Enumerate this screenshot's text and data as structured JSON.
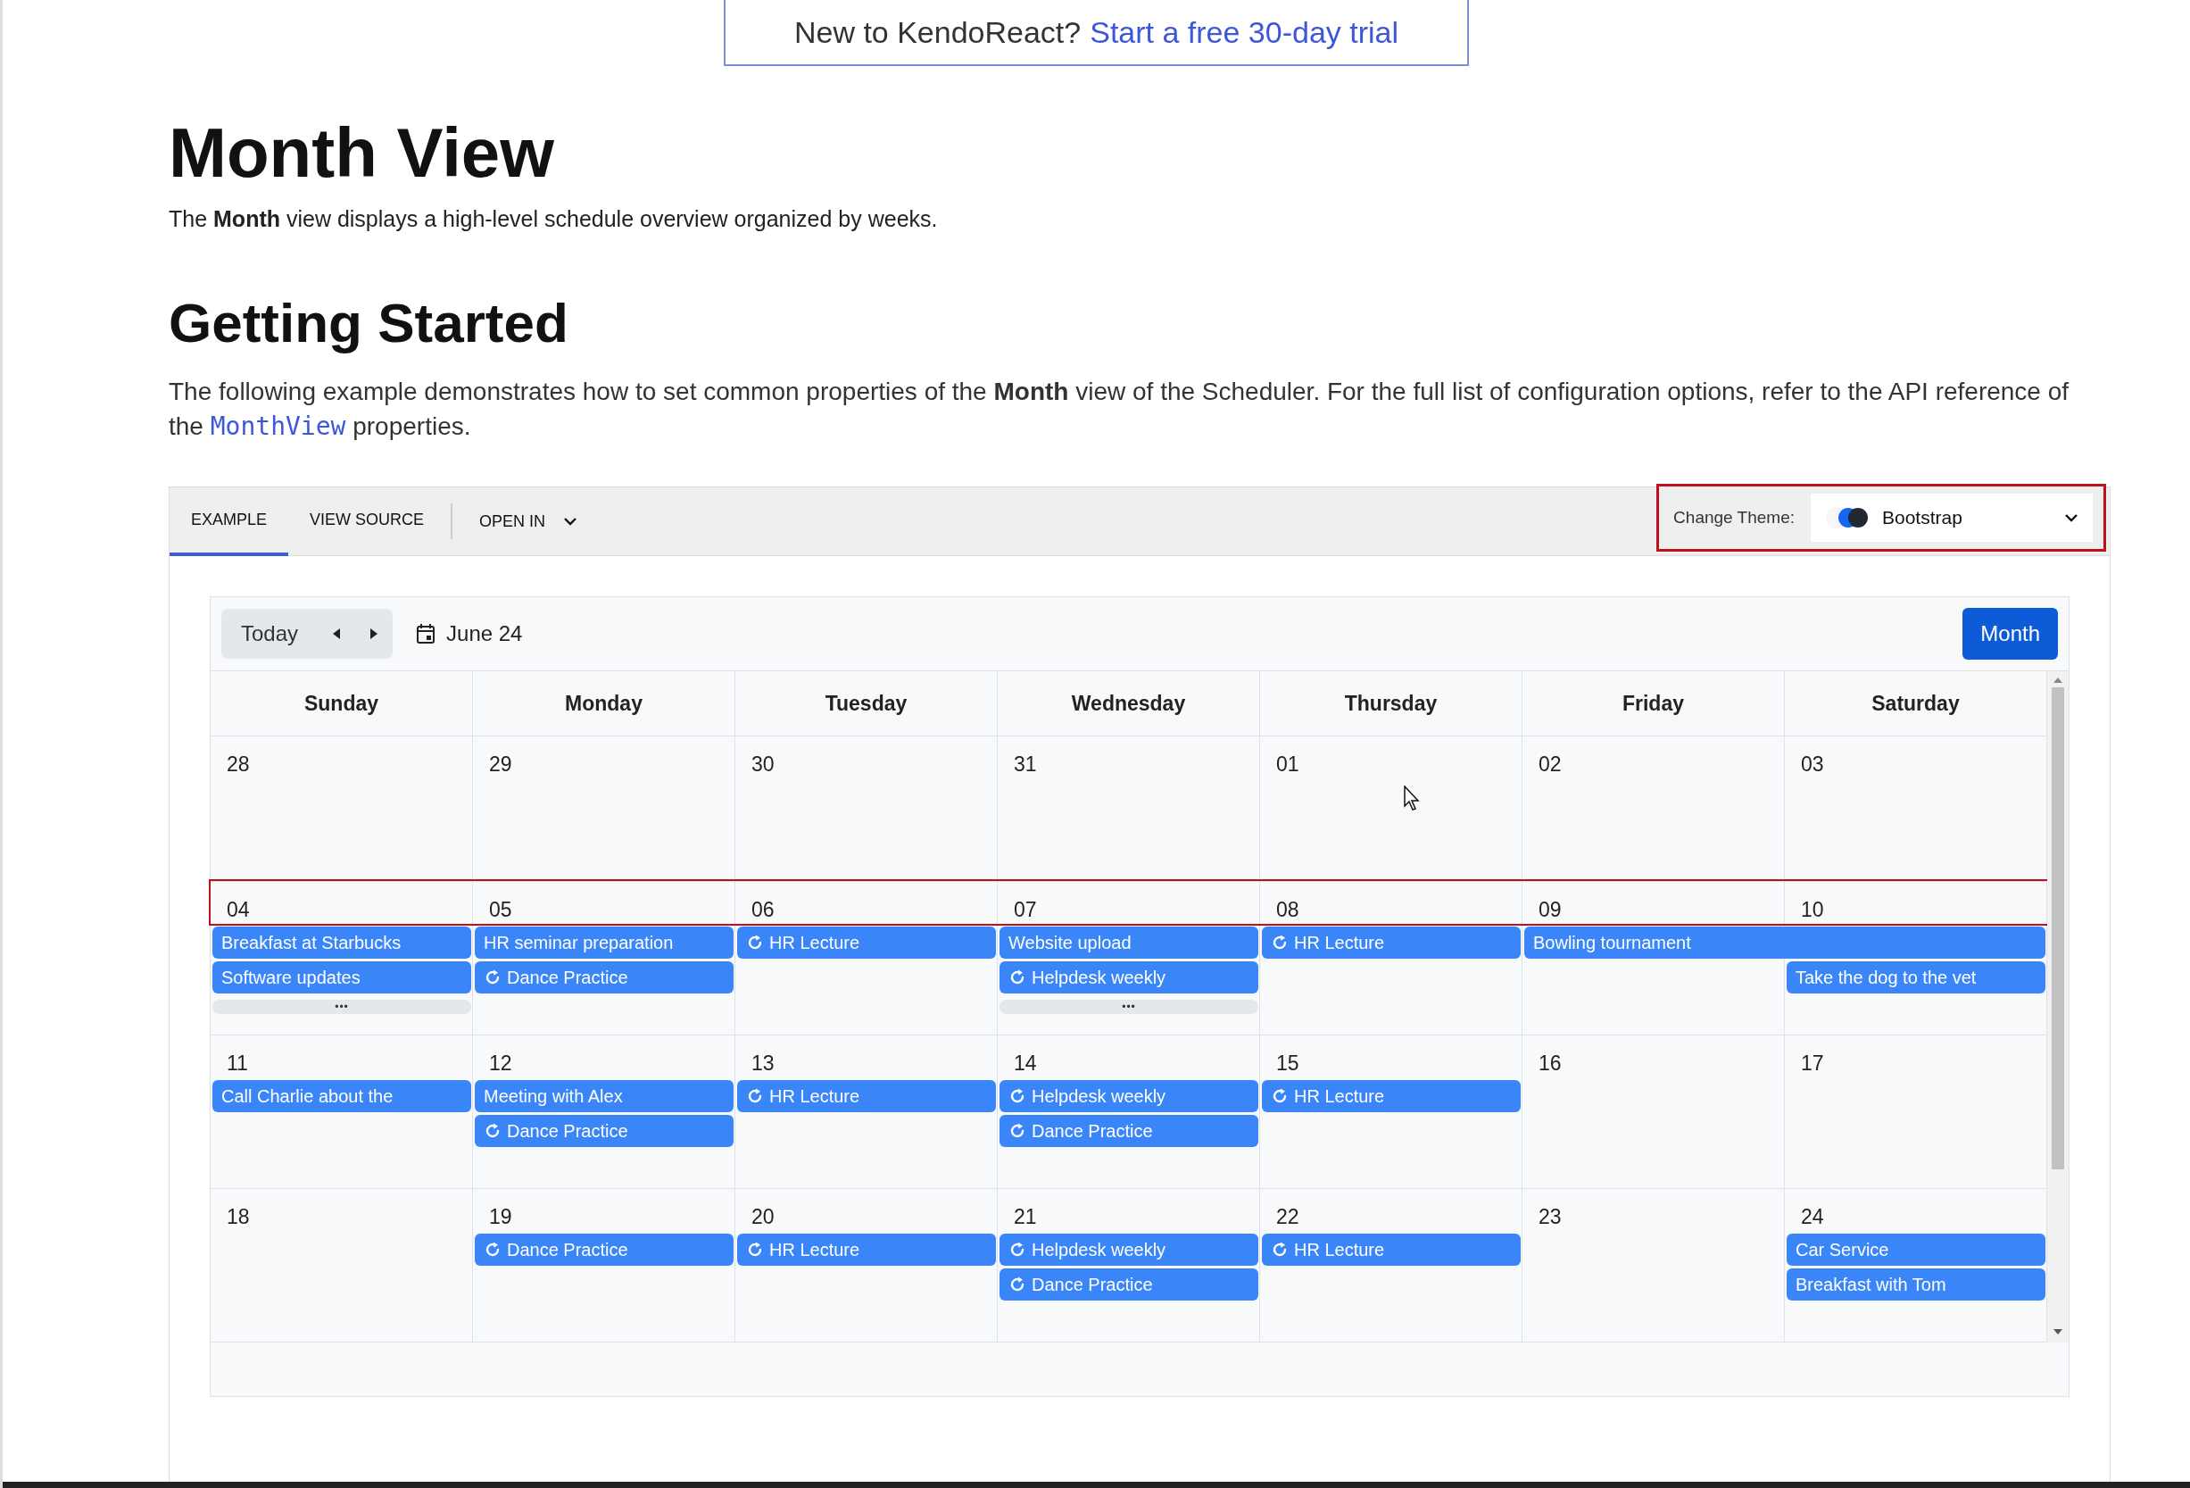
{
  "banner": {
    "text": "New to KendoReact?",
    "link": "Start a free 30-day trial"
  },
  "title": "Month View",
  "intro": "The **Month** view displays a high-level schedule overview organized by weeks.",
  "section_title": "Getting Started",
  "paragraph": {
    "before": "The following example demonstrates how to set common properties of the **Month** view of the Scheduler. For the full list of configuration options, refer to the API reference of the",
    "link": "MonthView",
    "after": "properties."
  },
  "tabs": [
    {
      "label": "EXAMPLE",
      "selected": true
    },
    {
      "label": "VIEW SOURCE",
      "selected": false
    }
  ],
  "open_in": "OPEN IN",
  "theme": {
    "label": "Change Theme:",
    "value": "Bootstrap"
  },
  "scheduler": {
    "today": "Today",
    "date": "June 24",
    "view": "Month",
    "days": [
      "Sunday",
      "Monday",
      "Tuesday",
      "Wednesday",
      "Thursday",
      "Friday",
      "Saturday"
    ],
    "weeks": [
      {
        "highlighted": false,
        "days": [
          {
            "date": "28"
          },
          {
            "date": "29"
          },
          {
            "date": "30"
          },
          {
            "date": "31"
          },
          {
            "date": "01"
          },
          {
            "date": "02"
          },
          {
            "date": "03"
          }
        ]
      },
      {
        "highlighted": true,
        "days": [
          {
            "date": "04",
            "events": [
              {
                "title": "Breakfast at Starbucks",
                "recurring": false,
                "continues": false
              },
              {
                "title": "Software updates",
                "recurring": false,
                "continues": false
              }
            ],
            "more": "•••"
          },
          {
            "date": "05",
            "events": [
              {
                "title": "HR seminar preparation",
                "recurring": false,
                "continues": false
              },
              {
                "title": "Dance Practice",
                "recurring": true,
                "continues": false
              }
            ]
          },
          {
            "date": "06",
            "events": [
              {
                "title": "HR Lecture",
                "recurring": true,
                "continues": false
              }
            ]
          },
          {
            "date": "07",
            "events": [
              {
                "title": "Website upload",
                "recurring": false,
                "continues": false
              },
              {
                "title": "Helpdesk weekly",
                "recurring": true,
                "continues": false
              }
            ],
            "more": "•••"
          },
          {
            "date": "08",
            "events": [
              {
                "title": "HR Lecture",
                "recurring": true,
                "continues": false
              }
            ]
          },
          {
            "date": "09",
            "events": [
              {
                "title": "Bowling tournament",
                "recurring": false,
                "continues": true
              }
            ]
          },
          {
            "date": "10",
            "events": [
              {
                "title": "Take the dog to the vet",
                "recurring": false,
                "continues": false
              }
            ]
          }
        ]
      },
      {
        "highlighted": false,
        "days": [
          {
            "date": "11",
            "events": [
              {
                "title": "Call Charlie about the",
                "recurring": false,
                "continues": false
              }
            ]
          },
          {
            "date": "12",
            "events": [
              {
                "title": "Meeting with Alex",
                "recurring": false,
                "continues": false
              },
              {
                "title": "Dance Practice",
                "recurring": true,
                "continues": false
              }
            ]
          },
          {
            "date": "13",
            "events": [
              {
                "title": "HR Lecture",
                "recurring": true,
                "continues": false
              }
            ]
          },
          {
            "date": "14",
            "events": [
              {
                "title": "Helpdesk weekly",
                "recurring": true,
                "continues": false
              },
              {
                "title": "Dance Practice",
                "recurring": true,
                "continues": false
              }
            ]
          },
          {
            "date": "15",
            "events": [
              {
                "title": "HR Lecture",
                "recurring": true,
                "continues": false
              }
            ]
          },
          {
            "date": "16"
          },
          {
            "date": "17"
          }
        ]
      },
      {
        "highlighted": false,
        "days": [
          {
            "date": "18"
          },
          {
            "date": "19",
            "events": [
              {
                "title": "Dance Practice",
                "recurring": true,
                "continues": false
              }
            ]
          },
          {
            "date": "20",
            "events": [
              {
                "title": "HR Lecture",
                "recurring": true,
                "continues": false
              }
            ]
          },
          {
            "date": "21",
            "events": [
              {
                "title": "Helpdesk weekly",
                "recurring": true,
                "continues": false
              },
              {
                "title": "Dance Practice",
                "recurring": true,
                "continues": false
              }
            ]
          },
          {
            "date": "22",
            "events": [
              {
                "title": "HR Lecture",
                "recurring": true,
                "continues": false
              }
            ]
          },
          {
            "date": "23"
          },
          {
            "date": "24",
            "events": [
              {
                "title": "Car Service",
                "recurring": false,
                "continues": false
              },
              {
                "title": "Breakfast with Tom",
                "recurring": false,
                "continues": false
              }
            ]
          }
        ]
      }
    ]
  }
}
